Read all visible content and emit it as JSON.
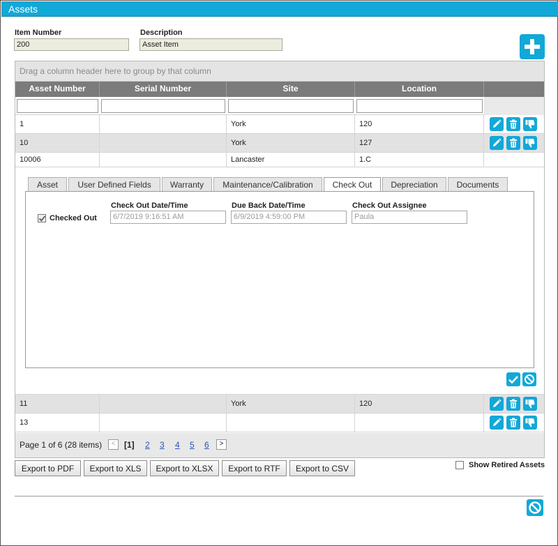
{
  "window": {
    "title": "Assets"
  },
  "form": {
    "item_number_label": "Item Number",
    "item_number_value": "200",
    "description_label": "Description",
    "description_value": "Asset Item"
  },
  "grid": {
    "group_panel_text": "Drag a column header here to group by that column",
    "columns": [
      "Asset Number",
      "Serial Number",
      "Site",
      "Location"
    ],
    "rows": [
      {
        "asset_number": "1",
        "serial_number": "",
        "site": "York",
        "location": "120",
        "actions": true
      },
      {
        "asset_number": "10",
        "serial_number": "",
        "site": "York",
        "location": "127",
        "actions": true
      },
      {
        "asset_number": "10006",
        "serial_number": "",
        "site": "Lancaster",
        "location": "1.C",
        "actions": false
      },
      {
        "asset_number": "11",
        "serial_number": "",
        "site": "York",
        "location": "120",
        "actions": true
      },
      {
        "asset_number": "13",
        "serial_number": "",
        "site": "",
        "location": "",
        "actions": true
      }
    ]
  },
  "detail": {
    "tabs": [
      "Asset",
      "User Defined Fields",
      "Warranty",
      "Maintenance/Calibration",
      "Check Out",
      "Depreciation",
      "Documents"
    ],
    "active_tab": "Check Out",
    "checked_out_label": "Checked Out",
    "checked_out": true,
    "check_out_date_label": "Check Out Date/Time",
    "check_out_date_value": "6/7/2019 9:16:51 AM",
    "due_back_label": "Due Back Date/Time",
    "due_back_value": "6/9/2019 4:59:00 PM",
    "assignee_label": "Check Out Assignee",
    "assignee_value": "Paula"
  },
  "pager": {
    "summary": "Page 1 of 6 (28 items)",
    "current": "[1]",
    "pages": [
      "2",
      "3",
      "4",
      "5",
      "6"
    ],
    "prev_glyph": "<",
    "next_glyph": ">"
  },
  "exports": [
    "Export to PDF",
    "Export to XLS",
    "Export to XLSX",
    "Export to RTF",
    "Export to CSV"
  ],
  "show_retired_label": "Show Retired Assets",
  "colors": {
    "accent": "#12a8d8",
    "header": "#7b7b7b",
    "alt_row": "#e2e2e2"
  },
  "icons": {
    "add": "plus-icon",
    "edit": "pencil-icon",
    "delete": "trash-icon",
    "retire": "thumbs-down-icon",
    "save": "check-icon",
    "cancel": "cancel-icon"
  }
}
